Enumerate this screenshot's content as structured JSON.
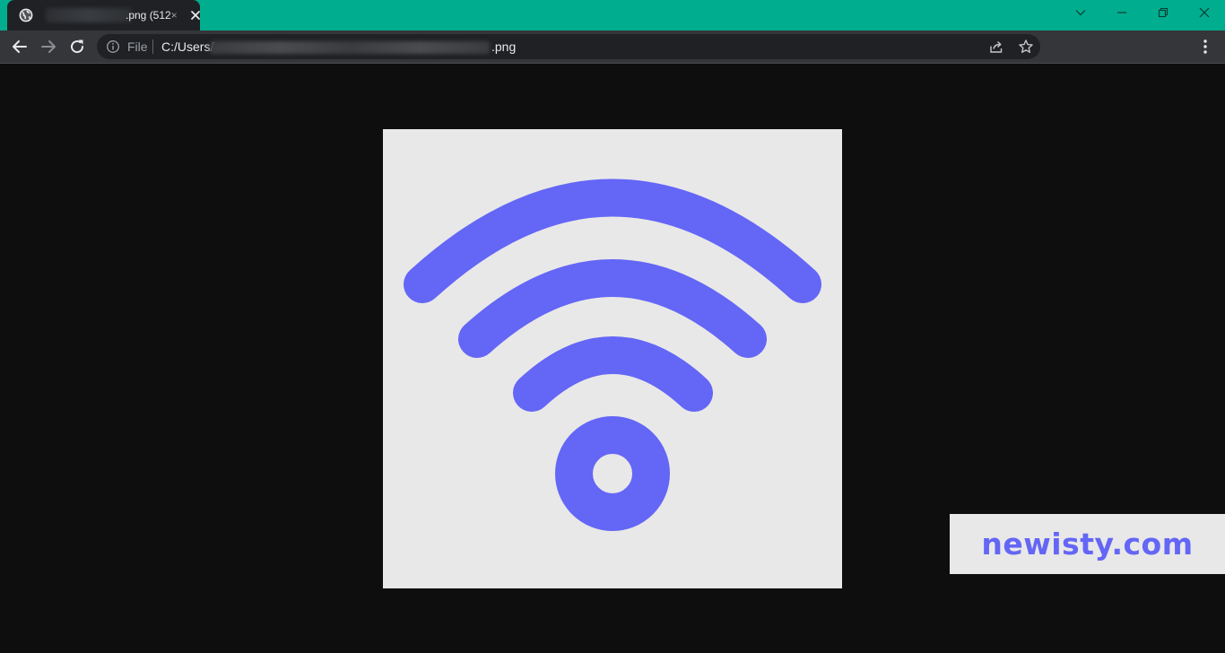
{
  "browser": {
    "tab": {
      "title": ".png (512×",
      "favicon": "globe-icon",
      "close_icon": "close-icon"
    },
    "window_controls": [
      "chevron-down-icon",
      "minimize-icon",
      "restore-icon",
      "close-icon"
    ],
    "toolbar": {
      "nav_icons": [
        "back-arrow-icon",
        "forward-arrow-icon",
        "reload-icon"
      ],
      "address": {
        "info_icon": "info-icon",
        "scheme_label": "File",
        "url_prefix": "C:/Users/",
        "url_suffix": ".png",
        "right_icons": [
          "share-icon",
          "star-icon"
        ]
      },
      "menu_icon": "kebab-menu-icon"
    },
    "colors": {
      "titlebar": "#00ad8e",
      "tab": "#202124",
      "toolbar": "#35363a",
      "viewer_background": "#0e0e0e"
    }
  },
  "content": {
    "image": {
      "subject": "wifi-icon",
      "background_color": "#e8e8e8",
      "icon_color": "#6466f6"
    },
    "watermark": {
      "text": "newisty.com",
      "color": "#6466f6",
      "background_color": "#e8e8e8"
    }
  }
}
